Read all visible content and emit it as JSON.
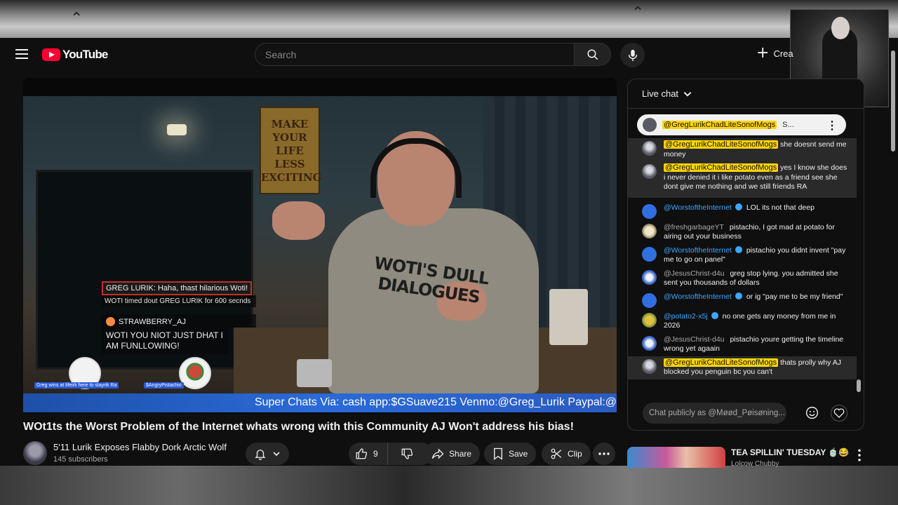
{
  "header": {
    "logo_text": "YouTube",
    "search_placeholder": "Search",
    "create_label": "Crea"
  },
  "video_overlay": {
    "poster_text": "MAKE YOUR LIFE LESS EXCITING",
    "shirt_text": "WOTI'S DULL DIALOGUES",
    "chat_line1": "GREG LURIK: Haha, thast hilarious Woti!",
    "chat_line2": "WOTI timed dout GREG LURIK for 600 secnds",
    "chat_user": "STRAWBERRY_AJ",
    "chat_msg": "WOTI YOU NIOT JUST DHAT I AM FUNLLOWING!",
    "avatar1_label": "Greg wins at lifeirk here to stayrik Ra",
    "avatar2_label": "$AngryPistachio",
    "ticker": "Super Chats Via: cash app:$GSuave215 Venmo:@Greg_Lurik Paypal:@"
  },
  "video": {
    "title": "WOt1ts the Worst Problem of the Internet whats wrong with this Community AJ Won't address his bias!",
    "channel_name": "5'11 Lurik Exposes Flabby Dork Arctic Wolf",
    "subscribers": "145 subscribers",
    "like_count": "9",
    "share_label": "Share",
    "save_label": "Save",
    "clip_label": "Clip"
  },
  "chat": {
    "header_label": "Live chat",
    "pinned": {
      "author": "@GregLurikChadLiteSonofMogs",
      "tail": "S..."
    },
    "messages": [
      {
        "author": "@GregLurikChadLiteSonofMogs",
        "text": "she doesnt send me money"
      },
      {
        "author": "@GregLurikChadLiteSonofMogs",
        "text": "yes I know she does i never denied it i like potato even as a friend see she dont give me nothing and we still friends RA"
      },
      {
        "author": "@WorstoftheInternet",
        "text": "LOL its not that deep"
      },
      {
        "author": "@freshgarbageYT",
        "text": "pistachio, I got mad at potato for airing out your business"
      },
      {
        "author": "@WorstoftheInternet",
        "text": "pistachio you didnt invent \"pay me to go on panel\""
      },
      {
        "author": "@JesusChrist-d4u",
        "text": "greg stop lying. you admitted she sent you thousands of dollars"
      },
      {
        "author": "@WorstoftheInternet",
        "text": "or ig \"pay me to be my friend\""
      },
      {
        "author": "@potato2-x5j",
        "text": "no one gets any money from me in 2026"
      },
      {
        "author": "@JesusChrist-d4u",
        "text": "pistachio youre getting the timeline wrong yet agaain"
      },
      {
        "author": "@GregLurikChadLiteSonofMogs",
        "text": "thats prolly why AJ blocked you penguin bc you can't"
      }
    ],
    "input_placeholder": "Chat publicly as @Møød_Pøisøning..."
  },
  "up_next": {
    "title": "TEA SPILLIN' TUESDAY 🍵😂",
    "channel": "Lolcow Chubby"
  },
  "colors": {
    "youtube_red": "#ff0033",
    "mention_yellow": "#ffd600",
    "verified_blue": "#3ea6ff",
    "ticker_blue": "#2a6ad8"
  },
  "icons": [
    "menu-icon",
    "youtube-logo-icon",
    "search-icon",
    "mic-icon",
    "plus-icon",
    "bell-icon",
    "chevron-down-icon",
    "thumbs-up-icon",
    "thumbs-down-icon",
    "share-icon",
    "bookmark-icon",
    "scissors-icon",
    "more-horiz-icon",
    "more-vert-icon",
    "emoji-icon",
    "heart-icon"
  ]
}
